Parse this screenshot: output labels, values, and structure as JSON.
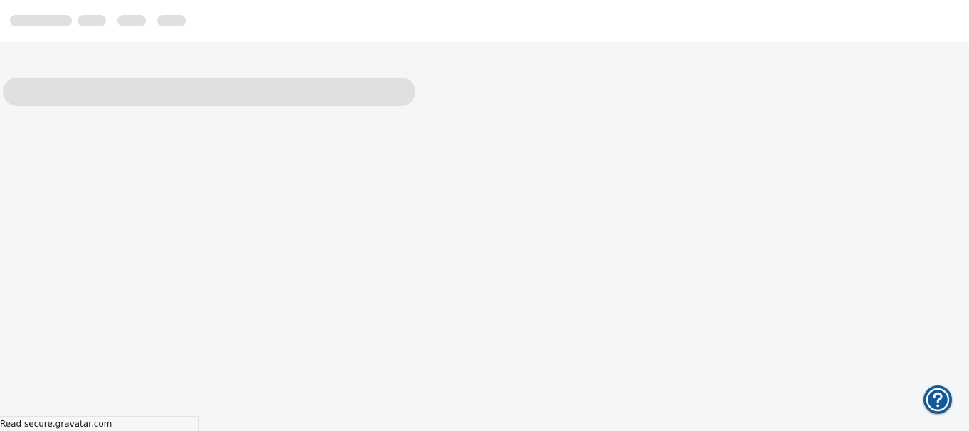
{
  "status_bar": {
    "text": "Read secure.gravatar.com"
  },
  "help": {
    "icon": "help-circle-icon",
    "color": "#145a99"
  },
  "colors": {
    "background": "#f5f6f6",
    "header": "#ffffff",
    "skeleton": "#e0e0e1"
  }
}
